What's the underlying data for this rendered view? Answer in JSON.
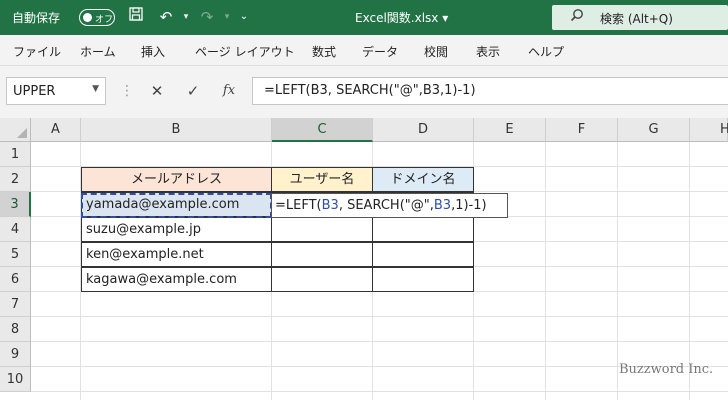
{
  "titlebar": {
    "autosave_label": "自動保存",
    "autosave_state": "オフ",
    "filename": "Excel関数.xlsx ▾",
    "search_placeholder": "検索 (Alt+Q)"
  },
  "ribbon": {
    "tabs": [
      "ファイル",
      "ホーム",
      "挿入",
      "ページ レイアウト",
      "数式",
      "データ",
      "校閲",
      "表示",
      "ヘルプ"
    ]
  },
  "formula_bar": {
    "name_box": "UPPER",
    "cancel_icon": "✕",
    "enter_icon": "✓",
    "fx_label": "fx",
    "formula": "=LEFT(B3, SEARCH(\"@\",B3,1)-1)"
  },
  "grid": {
    "columns": [
      "A",
      "B",
      "C",
      "D",
      "E",
      "F",
      "G",
      "H"
    ],
    "rows": [
      "1",
      "2",
      "3",
      "4",
      "5",
      "6",
      "7",
      "8",
      "9",
      "10"
    ],
    "headers": {
      "b2": "メールアドレス",
      "c2": "ユーザー名",
      "d2": "ドメイン名"
    },
    "emails": [
      "yamada@example.com",
      "suzu@example.jp",
      "ken@example.net",
      "kagawa@example.com"
    ],
    "edit": {
      "p1": "=LEFT(",
      "p2": "B3",
      "p3": ", SEARCH(\"@\",",
      "p4": "B3",
      "p5": ",1)-1)"
    }
  },
  "watermark": "Buzzword Inc.",
  "colors": {
    "accent": "#217346",
    "header_b": "#fce4d6",
    "header_c": "#fff2cc",
    "header_d": "#ddebf7",
    "ref_blue": "#2e4fa3"
  }
}
